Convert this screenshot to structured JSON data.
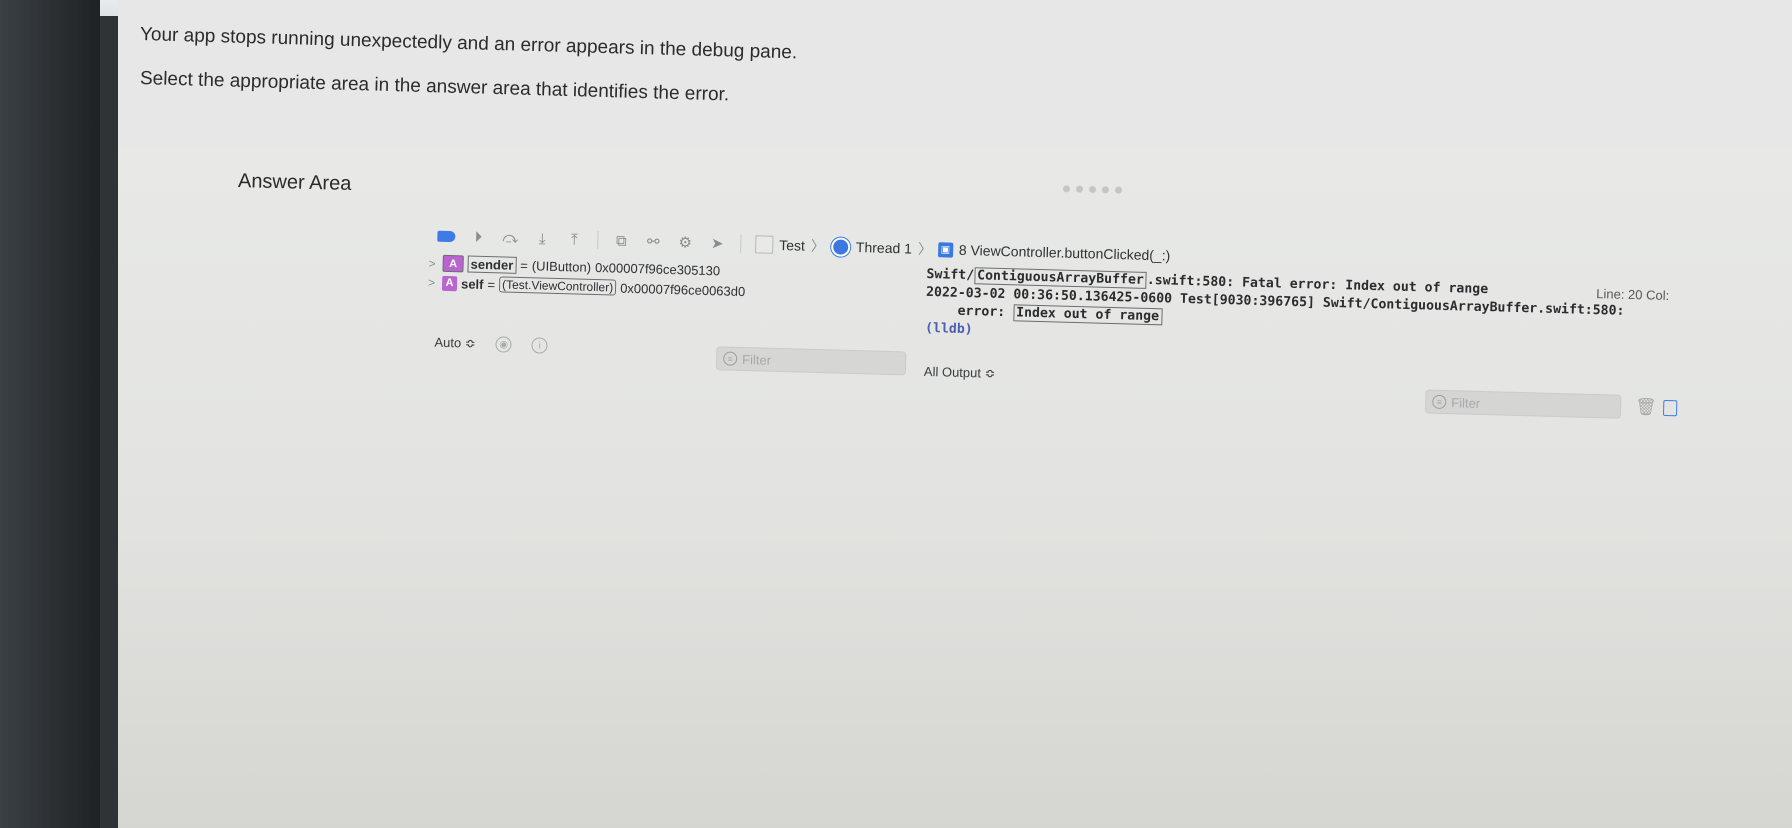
{
  "question": {
    "line1": "Your app stops running unexpectedly and an error appears in the debug pane.",
    "line2": "Select the appropriate area in the answer area that identifies the error."
  },
  "answer_area": {
    "title": "Answer Area"
  },
  "debug_bar": {
    "breadcrumb": {
      "project": "Test",
      "thread": "Thread 1",
      "frame": "8 ViewController.buttonClicked(_:)"
    }
  },
  "variables": [
    {
      "badge": "A",
      "name": "sender",
      "equals": "=",
      "type": "(UIButton)",
      "value": "0x00007f96ce305130"
    },
    {
      "badge": "A",
      "name": "self",
      "equals": "=",
      "type": "(Test.ViewController)",
      "value": "0x00007f96ce0063d0"
    }
  ],
  "variables_footer": {
    "scope_select": "Auto ≎",
    "filter_placeholder": "Filter"
  },
  "console": {
    "line1_prefix": "Swift/",
    "line1_boxed": "ContiguousArrayBuffer",
    "line1_suffix": ".swift:580: Fatal error: Index out of range",
    "line2": "2022-03-02 00:36:50.136425-0600 Test[9030:396765] Swift/ContiguousArrayBuffer.swift:580:",
    "line3_prefix": "error:",
    "line3_boxed": "Index out of range",
    "line4": "(lldb)",
    "line_col": "Line: 20  Col:",
    "output_select": "All Output ≎",
    "filter_placeholder": "Filter"
  }
}
